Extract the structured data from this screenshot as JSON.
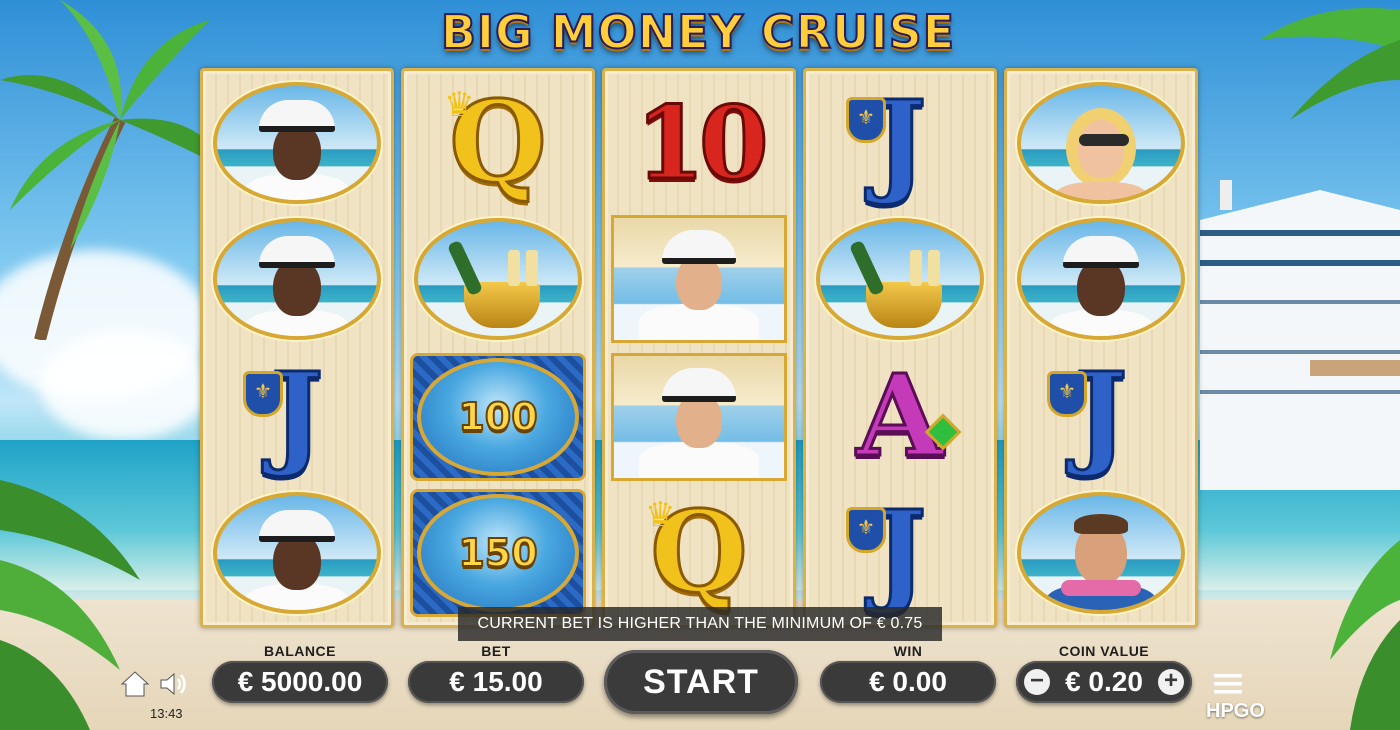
{
  "game": {
    "title": "BIG MONEY CRUISE"
  },
  "reels": {
    "reel1": [
      "female-officer",
      "female-officer",
      "J",
      "female-officer"
    ],
    "reel2": [
      "Q",
      "champagne",
      "100",
      "150"
    ],
    "reel3": [
      "10",
      "captain",
      "captain",
      "Q"
    ],
    "reel4": [
      "J",
      "champagne",
      "A",
      "J"
    ],
    "reel5": [
      "blonde-woman",
      "female-officer",
      "J",
      "man-with-lei"
    ]
  },
  "symbols": {
    "q": "Q",
    "j": "J",
    "ten": "10",
    "a": "A",
    "coin_100": "100",
    "coin_150": "150"
  },
  "message": "CURRENT BET IS HIGHER THAN THE MINIMUM OF € 0.75",
  "balance": {
    "label": "BALANCE",
    "value": "€ 5000.00"
  },
  "bet": {
    "label": "BET",
    "value": "€ 15.00"
  },
  "start": {
    "label": "START"
  },
  "win": {
    "label": "WIN",
    "value": "€ 0.00"
  },
  "coin_value": {
    "label": "COIN VALUE",
    "value": "€ 0.20",
    "minus": "−",
    "plus": "+"
  },
  "clock": "13:43",
  "brand": "HPGO",
  "colors": {
    "panel": "#3a3a3a",
    "gold": "#d7a934",
    "reel_bg": "#efe3c4"
  }
}
